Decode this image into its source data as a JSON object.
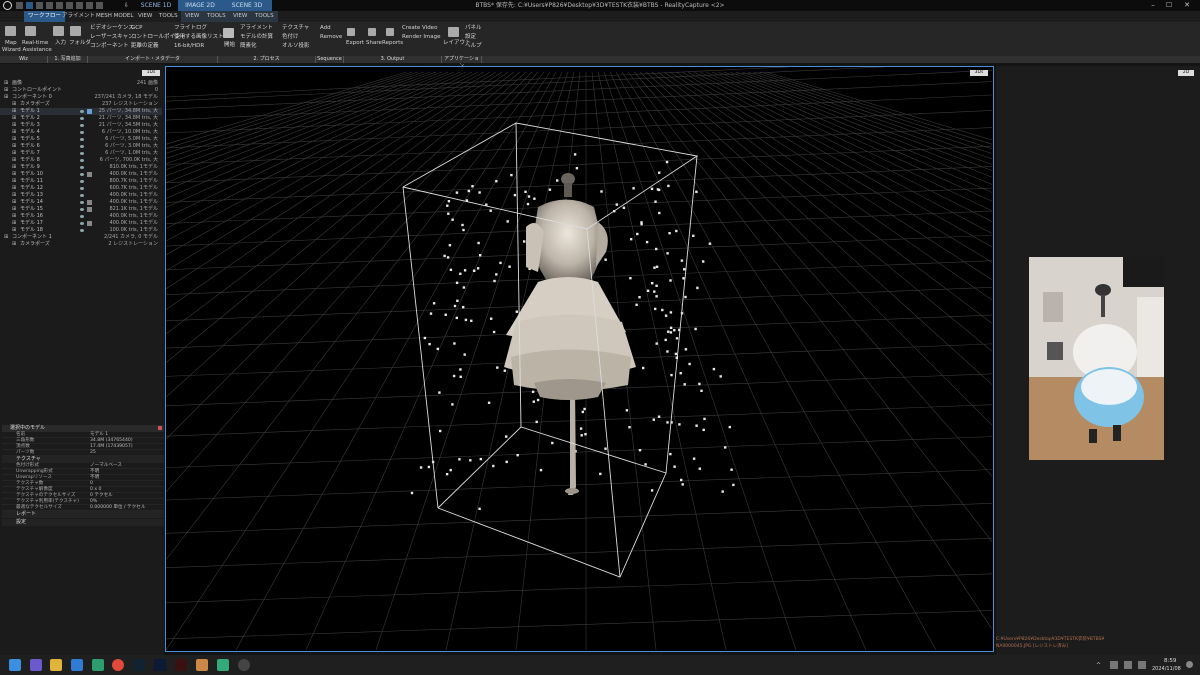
{
  "titlebar": {
    "title": "BTBS* 保存先: C:¥Users¥P826¥Desktop¥3D¥TESTK衣装¥BTBS - RealityCapture <2>",
    "scene_tabs": [
      "SCENE 1D",
      "IMAGE 2D",
      "SCENE 3D"
    ],
    "window_buttons": [
      "–",
      "☐",
      "✕"
    ]
  },
  "menubar": {
    "tabs": [
      "ワークフロー",
      "アライメント",
      "MESH MODEL",
      "VIEW",
      "TOOLS",
      "VIEW",
      "TOOLS",
      "VIEW",
      "TOOLS"
    ]
  },
  "ribbon": {
    "wiz": {
      "map": "Map",
      "wizard": "Wizard Assistance",
      "realtime": "Real-time"
    },
    "input": "入力",
    "folder": "フォルダ",
    "col1": [
      "ビデオシーケンス",
      "レーザースキャン",
      "コンポーネント"
    ],
    "gcp": "GCP",
    "col2": [
      "コントロールポイント",
      "距離の定義"
    ],
    "col3": [
      "フライトログ",
      "使用する画像リスト",
      "16-bit/HDR"
    ],
    "start": "開始",
    "col4": [
      "アライメント",
      "モデルの計算",
      "簡素化"
    ],
    "col5": [
      "テクスチャ",
      "色付け",
      "オルソ投影"
    ],
    "add": "Add",
    "remove": "Remove",
    "export": "Export",
    "share": "Share",
    "reports": "Reports",
    "create_video": "Create Video",
    "render_image": "Render Image",
    "layout": "レイアウト",
    "panel": "パネル",
    "settings": "設定",
    "help": "ヘルプ"
  },
  "groups": [
    "Wiz",
    "1. 写真追加",
    "インポート・メタデータ",
    "2. プロセス",
    "Sequence",
    "3. Output",
    "アプリケーション"
  ],
  "tree": {
    "badge": "1Ds",
    "rows": [
      {
        "label": "画像",
        "value": "241 画像",
        "indent": 1,
        "icon": ""
      },
      {
        "label": "コントロールポイント",
        "value": "0",
        "indent": 1,
        "icon": ""
      },
      {
        "label": "コンポーネント 0",
        "value": "237/241 カメラ, 18 モデル",
        "indent": 1,
        "icon": ""
      },
      {
        "label": "カメラポーズ",
        "value": "237 レジストレーション",
        "indent": 2,
        "icon": ""
      },
      {
        "label": "モデル 1",
        "value": "25 パーツ, 34.8M tris, 大",
        "indent": 2,
        "icon": "model"
      },
      {
        "label": "モデル 2",
        "value": "21 パーツ, 34.8M tris, 大",
        "indent": 2,
        "icon": ""
      },
      {
        "label": "モデル 3",
        "value": "21 パーツ, 34.5M tris, 大",
        "indent": 2,
        "icon": ""
      },
      {
        "label": "モデル 4",
        "value": "6 パーツ, 10.0M tris, 大",
        "indent": 2,
        "icon": ""
      },
      {
        "label": "モデル 5",
        "value": "6 パーツ, 5.0M tris, 大",
        "indent": 2,
        "icon": ""
      },
      {
        "label": "モデル 6",
        "value": "6 パーツ, 3.0M tris, 大",
        "indent": 2,
        "icon": ""
      },
      {
        "label": "モデル 7",
        "value": "6 パーツ, 1.0M tris, 大",
        "indent": 2,
        "icon": ""
      },
      {
        "label": "モデル 8",
        "value": "6 パーツ, 700.0K tris, 大",
        "indent": 2,
        "icon": ""
      },
      {
        "label": "モデル 9",
        "value": "810.0K tris, 1モデル",
        "indent": 2,
        "icon": ""
      },
      {
        "label": "モデル 10",
        "value": "400.0K tris, 1モデル",
        "indent": 2,
        "icon": "tex"
      },
      {
        "label": "モデル 11",
        "value": "800.7K tris, 1モデル",
        "indent": 2,
        "icon": ""
      },
      {
        "label": "モデル 12",
        "value": "600.7K tris, 1モデル",
        "indent": 2,
        "icon": ""
      },
      {
        "label": "モデル 13",
        "value": "400.0K tris, 1モデル",
        "indent": 2,
        "icon": ""
      },
      {
        "label": "モデル 14",
        "value": "400.0K tris, 1モデル",
        "indent": 2,
        "icon": "tex"
      },
      {
        "label": "モデル 15",
        "value": "821.1K tris, 1モデル",
        "indent": 2,
        "icon": "tex"
      },
      {
        "label": "モデル 16",
        "value": "400.0K tris, 1モデル",
        "indent": 2,
        "icon": ""
      },
      {
        "label": "モデル 17",
        "value": "400.0K tris, 1モデル",
        "indent": 2,
        "icon": "tex"
      },
      {
        "label": "モデル 18",
        "value": "100.0K tris, 1モデル",
        "indent": 2,
        "icon": ""
      },
      {
        "label": "コンポーネント 1",
        "value": "2/241 カメラ, 0 モデル",
        "indent": 1,
        "icon": ""
      },
      {
        "label": "カメラポーズ",
        "value": "2 レジストレーション",
        "indent": 2,
        "icon": ""
      }
    ]
  },
  "properties": {
    "header": "選択中のモデル",
    "rows": [
      {
        "k": "名前",
        "v": "モデル 1"
      },
      {
        "k": "三角形数",
        "v": "34.8M (34765440)"
      },
      {
        "k": "頂点数",
        "v": "17.4M (17439057)"
      },
      {
        "k": "パーツ数",
        "v": "25"
      }
    ],
    "texture_section": "テクスチャ",
    "texture_rows": [
      {
        "k": "色付け形式",
        "v": "ノーマルベース"
      },
      {
        "k": "Unwrapping形式",
        "v": "不明"
      },
      {
        "k": "Unwrapリソース",
        "v": "不明"
      },
      {
        "k": "テクスチャ数",
        "v": "0"
      },
      {
        "k": "テクスチャ解像度",
        "v": "0 x 0"
      },
      {
        "k": "テクスチャのテクセルサイズ",
        "v": "0 テクセル"
      },
      {
        "k": "テクスチャ利用率(テクスチャ)",
        "v": "0%"
      },
      {
        "k": "最適なテクセルサイズ",
        "v": "0.000000 単位 / テクセル"
      }
    ],
    "report_section": "レポート",
    "settings_section": "設定"
  },
  "viewport": {
    "badge": "3Ds"
  },
  "rightpanel": {
    "badge": "2D",
    "path1": "C:¥Users¥P826¥Desktop¥3D¥TESTK衣装¥BTBS¥",
    "path2": "NA0000045.JPG [レジストレ済み]"
  },
  "taskbar": {
    "time": "8:59",
    "date": "2024/11/08"
  }
}
